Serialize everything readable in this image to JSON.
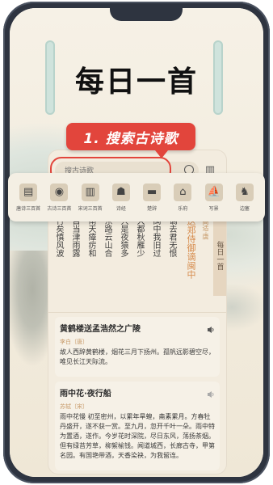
{
  "title": "每日一首",
  "callout": "1. 搜索古诗歌",
  "search": {
    "placeholder": "搜古诗歌"
  },
  "categories": [
    {
      "label": "唐诗三百首",
      "icon": "book-icon"
    },
    {
      "label": "古诗三百首",
      "icon": "lamp-icon"
    },
    {
      "label": "宋词三百首",
      "icon": "book2-icon"
    },
    {
      "label": "诗经",
      "icon": "sage-icon"
    },
    {
      "label": "楚辞",
      "icon": "bamboo-icon"
    },
    {
      "label": "乐府",
      "icon": "pavilion-icon"
    },
    {
      "label": "写景",
      "icon": "boat-icon"
    },
    {
      "label": "边塞",
      "icon": "camel-icon"
    }
  ],
  "daily": {
    "lines": [
      "行矣慎风波",
      "自当津雨露",
      "南天瘴疠和",
      "东路云山合",
      "只是夜猿多",
      "大都秋雁少",
      "闽中我旧过",
      "谪去君无恨"
    ],
    "title": "送郑侍御谪闽中",
    "author": "高适·唐",
    "tag": "每日一首"
  },
  "poems": [
    {
      "title": "黄鹤楼送孟浩然之广陵",
      "author": "李白〔唐〕",
      "body": "故人西辞黄鹤楼，烟花三月下扬州。孤帆远影碧空尽，唯见长江天际流。"
    },
    {
      "title": "雨中花·夜行船",
      "author": "苏轼〔宋〕",
      "body": "雨中花慢 初至密州，以累年旱蝗，斋素累月。方春牡丹盛开，遂不获一赏。至九月，忽开千叶一朵。雨中特为置酒，遂作。今岁花时深院，尽日东风，荡扬茶烟。但有绿苔芳草，柳絮榆钱。闻道城西，长廊古寺，甲第名园。有国艳带酒，天香染袂，为我留连。"
    }
  ],
  "colors": {
    "accent": "#e2453c",
    "bg": "#f0eadb"
  }
}
